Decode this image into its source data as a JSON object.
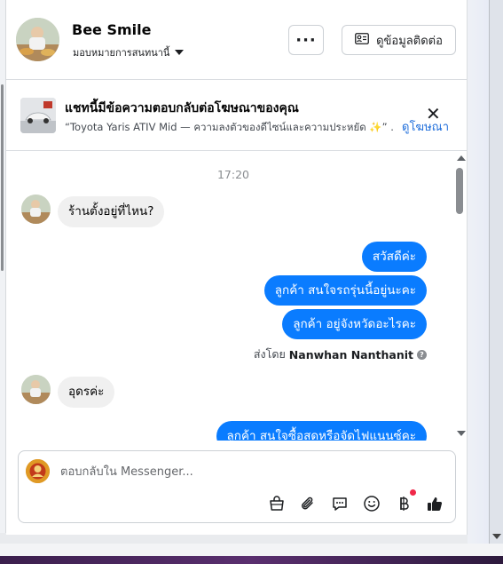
{
  "header": {
    "name": "Bee Smile",
    "assign_label": "มอบหมายการสนทนานี้",
    "more_label": "···",
    "contact_button": "ดูข้อมูลติดต่อ"
  },
  "banner": {
    "title": "แชทนี้มีข้อความตอบกลับต่อโฆษณาของคุณ",
    "text": "“Toyota Yaris ATIV Mid — ความลงตัวของดีไซน์และความประหยัด ✨” ...",
    "link": "ดูโฆษณา",
    "close": "✕"
  },
  "thread": {
    "time": "17:20",
    "incoming_1": "ร้านตั้งอยู่ที่ไหน?",
    "outgoing": [
      "สวัสดีค่ะ",
      "ลูกค้า สนใจรถรุ่นนี้อยู่นะคะ",
      "ลูกค้า อยู่จังหวัดอะไรคะ"
    ],
    "sent_by_prefix": "ส่งโดย",
    "sent_by_name": "Nanwhan Nanthanit",
    "incoming_2": "อุดรค่ะ",
    "outgoing_partial": "ลูกค้า สนใจซื้อสดหรือจัดไฟแนนซ์คะ"
  },
  "composer": {
    "placeholder": "ตอบกลับใน Messenger..."
  },
  "icons": [
    "bag-icon",
    "paperclip-icon",
    "chat-reply-icon",
    "emoji-icon",
    "baht-icon",
    "thumbs-up-icon"
  ],
  "colors": {
    "accent": "#0a7cff",
    "link": "#216fdb",
    "incoming_bubble": "#f0f0f0",
    "notification_dot": "#f02849"
  }
}
